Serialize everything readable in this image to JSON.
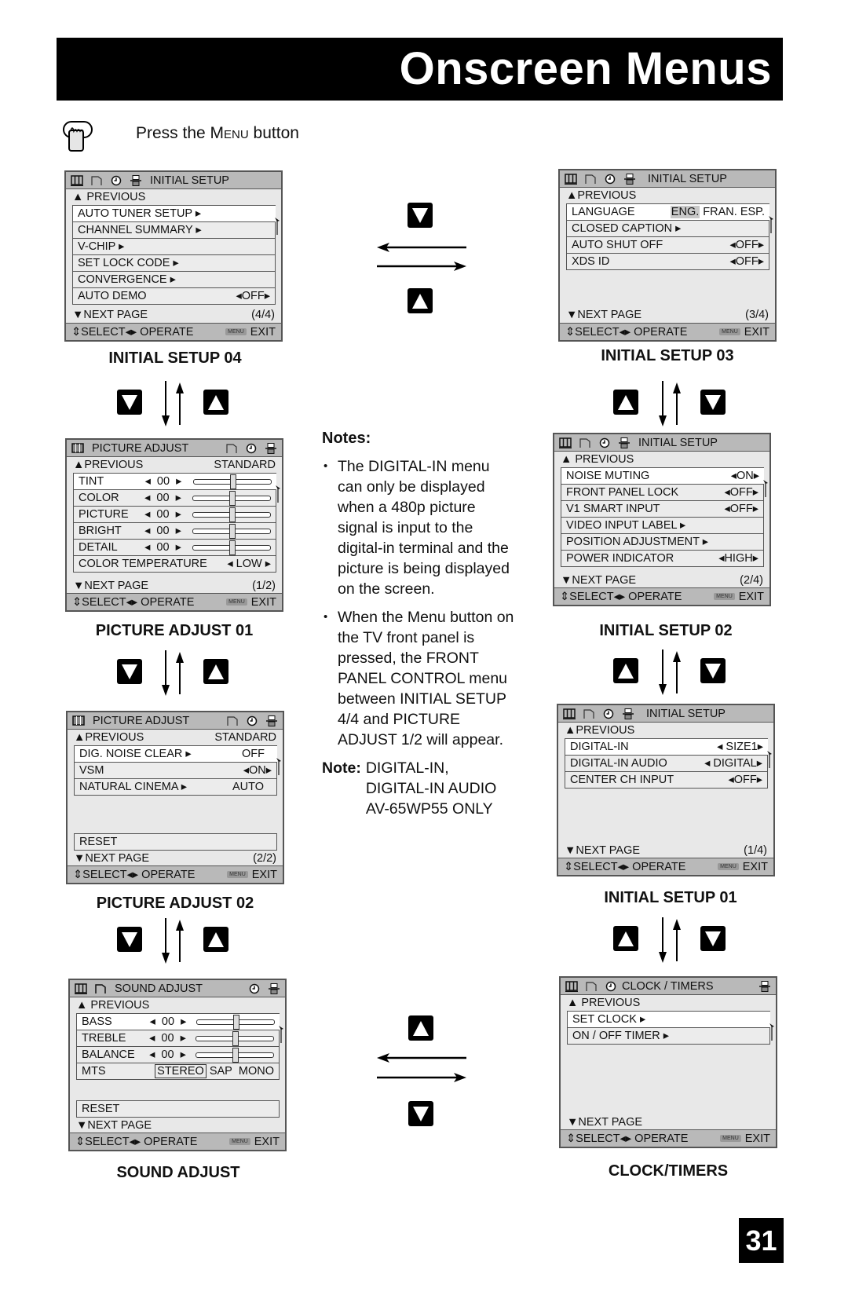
{
  "page": {
    "title": "Onscreen Menus",
    "instruction_prefix": "Press the ",
    "instruction_key": "Menu",
    "instruction_suffix": " button",
    "page_number": "31"
  },
  "common": {
    "previous": "PREVIOUS",
    "next_page": "NEXT PAGE",
    "select": "SELECT",
    "operate": "OPERATE",
    "menu_key": "MENU",
    "exit": "EXIT"
  },
  "menus": {
    "initial_setup_04": {
      "caption": "INITIAL SETUP 04",
      "title": "INITIAL SETUP",
      "page": "(4/4)",
      "items": [
        {
          "label": "AUTO TUNER SETUP ▸",
          "value": ""
        },
        {
          "label": "CHANNEL SUMMARY ▸",
          "value": ""
        },
        {
          "label": "V-CHIP ▸",
          "value": ""
        },
        {
          "label": "SET LOCK CODE ▸",
          "value": ""
        },
        {
          "label": "CONVERGENCE ▸",
          "value": ""
        },
        {
          "label": "AUTO DEMO",
          "value": "◂OFF▸"
        }
      ]
    },
    "initial_setup_03": {
      "caption": "INITIAL SETUP 03",
      "title": "INITIAL SETUP",
      "page": "(3/4)",
      "language_label": "LANGUAGE",
      "language_options": [
        "ENG.",
        "FRAN.",
        "ESP."
      ],
      "language_selected": "ENG.",
      "items": [
        {
          "label": "CLOSED CAPTION ▸",
          "value": ""
        },
        {
          "label": "AUTO SHUT OFF",
          "value": "◂OFF▸"
        },
        {
          "label": "XDS ID",
          "value": "◂OFF▸"
        }
      ]
    },
    "picture_adjust_01": {
      "caption": "PICTURE ADJUST 01",
      "title": "PICTURE ADJUST",
      "mode": "STANDARD",
      "page": "(1/2)",
      "sliders": [
        {
          "label": "TINT",
          "value": "00",
          "position": 0.5
        },
        {
          "label": "COLOR",
          "value": "00",
          "position": 0.5
        },
        {
          "label": "PICTURE",
          "value": "00",
          "position": 0.5
        },
        {
          "label": "BRIGHT",
          "value": "00",
          "position": 0.5
        },
        {
          "label": "DETAIL",
          "value": "00",
          "position": 0.5
        }
      ],
      "color_temp_label": "COLOR TEMPERATURE",
      "color_temp_value": "◂ LOW ▸"
    },
    "initial_setup_02": {
      "caption": "INITIAL SETUP 02",
      "title": "INITIAL SETUP",
      "page": "(2/4)",
      "items": [
        {
          "label": "NOISE MUTING",
          "value": "◂ON▸"
        },
        {
          "label": "FRONT PANEL LOCK",
          "value": "◂OFF▸"
        },
        {
          "label": "V1 SMART INPUT",
          "value": "◂OFF▸"
        },
        {
          "label": "VIDEO INPUT LABEL ▸",
          "value": ""
        },
        {
          "label": "POSITION ADJUSTMENT ▸",
          "value": ""
        },
        {
          "label": "POWER INDICATOR",
          "value": "◂HIGH▸"
        }
      ]
    },
    "picture_adjust_02": {
      "caption": "PICTURE ADJUST 02",
      "title": "PICTURE ADJUST",
      "mode": "STANDARD",
      "page": "(2/2)",
      "items": [
        {
          "label": "DIG. NOISE CLEAR ▸",
          "value": "OFF"
        },
        {
          "label": "VSM",
          "value": "◂ON▸"
        },
        {
          "label": "NATURAL CINEMA ▸",
          "value": "AUTO"
        }
      ],
      "reset": "RESET"
    },
    "initial_setup_01": {
      "caption": "INITIAL SETUP 01",
      "title": "INITIAL SETUP",
      "page": "(1/4)",
      "items": [
        {
          "label": "DIGITAL-IN",
          "value": "◂ SIZE1▸"
        },
        {
          "label": "DIGITAL-IN AUDIO",
          "value": "◂ DIGITAL▸"
        },
        {
          "label": "CENTER CH INPUT",
          "value": "◂OFF▸"
        }
      ]
    },
    "sound_adjust": {
      "caption": "SOUND ADJUST",
      "title": "SOUND ADJUST",
      "sliders": [
        {
          "label": "BASS",
          "value": "00",
          "position": 0.5
        },
        {
          "label": "TREBLE",
          "value": "00",
          "position": 0.5
        },
        {
          "label": "BALANCE",
          "value": "00",
          "position": 0.5
        }
      ],
      "mts_label": "MTS",
      "mts_options": [
        "STEREO",
        "SAP",
        "MONO"
      ],
      "mts_selected": "STEREO",
      "reset": "RESET"
    },
    "clock_timers": {
      "caption": "CLOCK/TIMERS",
      "title": "CLOCK / TIMERS",
      "items": [
        {
          "label": "SET CLOCK ▸",
          "value": ""
        },
        {
          "label": "ON / OFF TIMER ▸",
          "value": ""
        }
      ]
    }
  },
  "notes": {
    "heading": "Notes:",
    "bullets": [
      "The DIGITAL-IN menu can only be displayed when a 480p picture signal is input to the digital-in terminal and the picture is being displayed on the screen.",
      "When the Menu button on the TV front panel is pressed, the FRONT PANEL CONTROL menu between INITIAL SETUP 4/4 and PICTURE ADJUST 1/2 will appear."
    ],
    "note_label": "Note:",
    "note_lines": [
      "DIGITAL-IN,",
      "DIGITAL-IN AUDIO",
      "AV-65WP55 ONLY"
    ]
  }
}
